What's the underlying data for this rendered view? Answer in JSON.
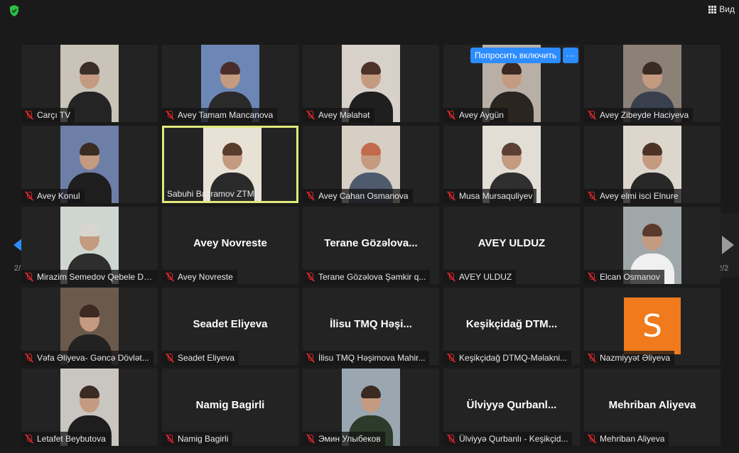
{
  "topbar": {
    "view_label": "Вид"
  },
  "overlay": {
    "ask_unmute_label": "Попросить включить",
    "more_label": "···"
  },
  "pager": {
    "page_text": "2/2"
  },
  "tiles": [
    {
      "name": "Carçı TV",
      "video": true
    },
    {
      "name": "Avey Tamam Mancanova",
      "video": true
    },
    {
      "name": "Avey Məlahət",
      "video": true
    },
    {
      "name": "Avey Aygün",
      "video": true
    },
    {
      "name": "Avey Zibeyde Haciyeva",
      "video": true
    },
    {
      "name": "Avey Konul",
      "video": true
    },
    {
      "name": "Sabuhi Bayramov ZTMQ",
      "video": true,
      "active": true
    },
    {
      "name": "Avey Cahan Osmanova",
      "video": true
    },
    {
      "name": "Musa Mursaquliyev",
      "video": true
    },
    {
      "name": "Avey elmi isci Elnure",
      "video": true
    },
    {
      "name": "Mirazim Semedov Qebele DT...",
      "video": true
    },
    {
      "name": "Avey Novreste",
      "big": "Avey Novreste"
    },
    {
      "name": "Terane Gözəlova Şəmkir q...",
      "big": "Terane  Gözəlova..."
    },
    {
      "name": "AVEY ULDUZ",
      "big": "AVEY ULDUZ"
    },
    {
      "name": "Elcan Osmanov",
      "video": true
    },
    {
      "name": "Vəfa Əliyeva- Gəncə Dövlət...",
      "video": true
    },
    {
      "name": "Seadet Eliyeva",
      "big": "Seadet Eliyeva"
    },
    {
      "name": "İlisu TMQ Həşimova Mahir...",
      "big": "İlisu  TMQ  Həşi..."
    },
    {
      "name": "Keşikçidağ DTMQ-Məlakni...",
      "big": "Keşikçidağ  DTM..."
    },
    {
      "name": "Nazmiyyət Əliyeva",
      "avatar": "S"
    },
    {
      "name": "Letafet Beybutova",
      "video": true
    },
    {
      "name": "Namig Bagirli",
      "big": "Namig Bagirli"
    },
    {
      "name": "Эмин Улыбеков",
      "video": true
    },
    {
      "name": "Ülviyyə Qurbanlı - Keşikçid...",
      "big": "Ülviyyə  Qurbanl..."
    },
    {
      "name": "Mehriban Aliyeva",
      "big": "Mehriban Aliyeva"
    }
  ]
}
